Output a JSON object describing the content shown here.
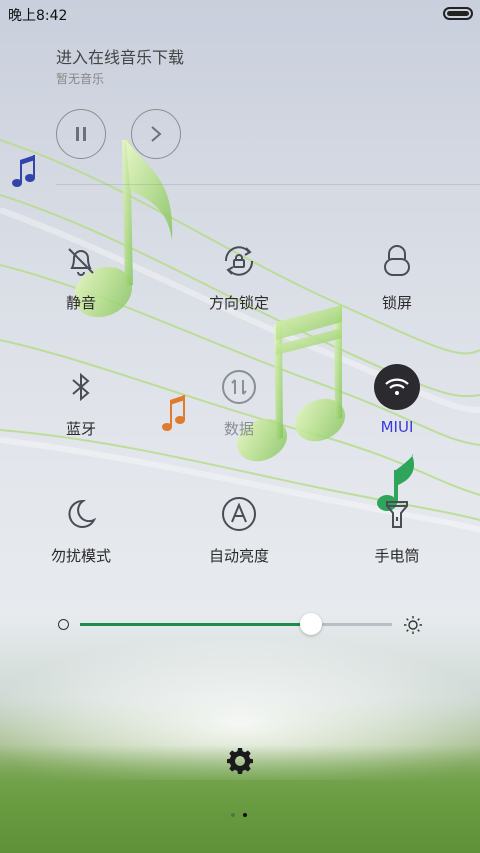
{
  "status_bar": {
    "time": "晚上8:42",
    "battery_icon": "battery-full-icon"
  },
  "music": {
    "title": "进入在线音乐下载",
    "subtitle": "暂无音乐",
    "pause_icon": "pause-icon",
    "next_icon": "next-icon"
  },
  "toggles": {
    "mute": {
      "label": "静音",
      "icon": "bell-off-icon",
      "state": "off"
    },
    "rotation_lock": {
      "label": "方向锁定",
      "icon": "rotation-lock-icon",
      "state": "off"
    },
    "lock_screen": {
      "label": "锁屏",
      "icon": "lock-icon",
      "state": "off"
    },
    "bluetooth": {
      "label": "蓝牙",
      "icon": "bluetooth-icon",
      "state": "off"
    },
    "data": {
      "label": "数据",
      "icon": "mobile-data-icon",
      "state": "disabled"
    },
    "wifi": {
      "label": "MIUI",
      "icon": "wifi-icon",
      "state": "on"
    },
    "do_not_disturb": {
      "label": "勿扰模式",
      "icon": "moon-icon",
      "state": "off"
    },
    "auto_brightness": {
      "label": "自动亮度",
      "icon": "auto-brightness-icon",
      "state": "off"
    },
    "flashlight": {
      "label": "手电筒",
      "icon": "flashlight-icon",
      "state": "off"
    }
  },
  "brightness": {
    "level": 0.74,
    "low_icon": "brightness-low-icon",
    "high_icon": "brightness-high-icon"
  },
  "settings_icon": "gear-icon",
  "page_indicator": {
    "pages": 2,
    "current": 2
  },
  "colors": {
    "accent": "#1e8c4c",
    "wifi_active_bg": "#2b2b2f",
    "wifi_label": "#3a3adc",
    "bluetooth_note": "#3344aa",
    "orange_note": "#e07a2c"
  }
}
